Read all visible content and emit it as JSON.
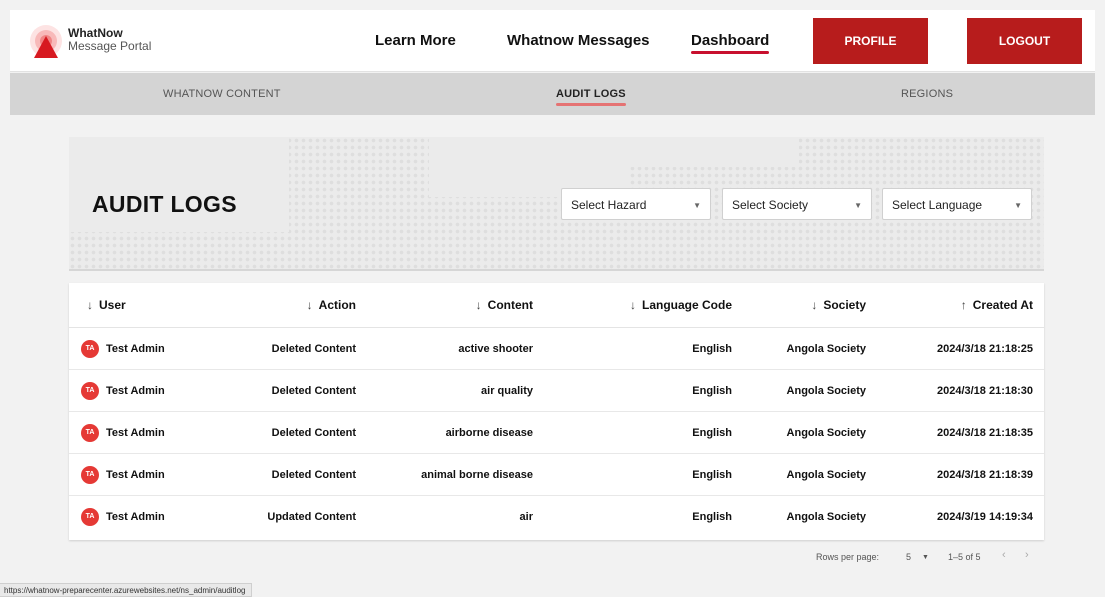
{
  "brand": {
    "line1": "WhatNow",
    "line2": "Message Portal"
  },
  "nav": {
    "learn_more": "Learn More",
    "messages": "Whatnow Messages",
    "dashboard": "Dashboard"
  },
  "buttons": {
    "profile": "PROFILE",
    "logout": "LOGOUT"
  },
  "subnav": {
    "content": "WHATNOW CONTENT",
    "audit": "AUDIT LOGS",
    "regions": "REGIONS"
  },
  "page": {
    "title": "AUDIT LOGS"
  },
  "filters": {
    "hazard": "Select Hazard",
    "society": "Select Society",
    "language": "Select Language"
  },
  "table": {
    "headers": {
      "user": "User",
      "action": "Action",
      "content": "Content",
      "language": "Language Code",
      "society": "Society",
      "created": "Created At"
    },
    "rows": [
      {
        "initials": "TA",
        "user": "Test Admin",
        "action": "Deleted Content",
        "content": "active shooter",
        "language": "English",
        "society": "Angola Society",
        "created": "2024/3/18 21:18:25"
      },
      {
        "initials": "TA",
        "user": "Test Admin",
        "action": "Deleted Content",
        "content": "air quality",
        "language": "English",
        "society": "Angola Society",
        "created": "2024/3/18 21:18:30"
      },
      {
        "initials": "TA",
        "user": "Test Admin",
        "action": "Deleted Content",
        "content": "airborne disease",
        "language": "English",
        "society": "Angola Society",
        "created": "2024/3/18 21:18:35"
      },
      {
        "initials": "TA",
        "user": "Test Admin",
        "action": "Deleted Content",
        "content": "animal borne disease",
        "language": "English",
        "society": "Angola Society",
        "created": "2024/3/18 21:18:39"
      },
      {
        "initials": "TA",
        "user": "Test Admin",
        "action": "Updated Content",
        "content": "air",
        "language": "English",
        "society": "Angola Society",
        "created": "2024/3/19 14:19:34"
      }
    ]
  },
  "pagination": {
    "rows_label": "Rows per page:",
    "rows_value": "5",
    "range": "1–5 of 5"
  },
  "status_url": "https://whatnow-preparecenter.azurewebsites.net/ns_admin/auditlog",
  "colors": {
    "brand_red": "#b71c1c",
    "accent_red": "#c8102e",
    "avatar_red": "#e53935"
  }
}
